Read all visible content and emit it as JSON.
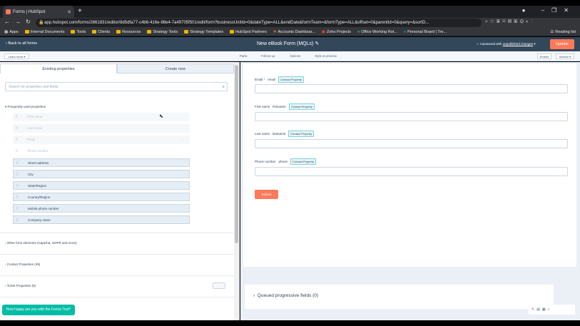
{
  "browser": {
    "tab_title": "Forms | HubSpot",
    "url": "app.hubspot.com/forms/2661831/editor/8d5dfa77-c4b6-416e-98e4-7a49705f501/edit/form?businessUnitId=0&dateType=ALL&endDate&formTeam=&formType=ALL&offset=0&parentId=0&query=&sortD...",
    "bookmarks": [
      "Apps",
      "Internal Documents",
      "Tools",
      "Clients",
      "Resources",
      "Strategy Tools",
      "Strategy Templates",
      "HubSpot Partners",
      "Accounts Dashboar...",
      "Zoho Projects",
      "Office Working Rot...",
      "Personal Board | Tre..."
    ],
    "reading_list": "Reading list"
  },
  "header": {
    "back_label": "Back to all forms",
    "form_title": "New eBook Form (MQLs)",
    "autosave_prefix": "Autosaved with",
    "autosave_link": "unpublished changes",
    "update_button": "Update"
  },
  "subnav": {
    "learn_more": "Learn more",
    "tabs": [
      "Form",
      "Follow-up",
      "Options",
      "Style & preview"
    ],
    "embed": "Embed",
    "actions": "Actions"
  },
  "left_panel": {
    "tabs": [
      "Existing properties",
      "Create new"
    ],
    "search_placeholder": "Search for properties and fields",
    "frequently_used": "Frequently used properties",
    "dim_fields": [
      "First name",
      "Last name",
      "Email",
      "Phone number"
    ],
    "active_fields": [
      "Street address",
      "City",
      "State/Region",
      "Country/Region",
      "Mobile phone number",
      "Company name"
    ],
    "other_elements": "Other form elements (Captcha, GDPR and more)",
    "contact_properties": "Contact Properties (49)",
    "ticket_properties": "Ticket Properties (9)",
    "feedback_button": "How happy are you with the Forms Tool?"
  },
  "form_preview": {
    "fields": [
      {
        "label": "Email *",
        "internal": "email",
        "badge": "Contact Property"
      },
      {
        "label": "First name",
        "internal": "firstname",
        "badge": "Contact Property"
      },
      {
        "label": "Last name",
        "internal": "lastname",
        "badge": "Contact Property"
      },
      {
        "label": "Phone number",
        "internal": "phone",
        "badge": "Contact Property"
      }
    ],
    "submit_label": "Submit",
    "queued_label": "Queued progressive fields (0)"
  },
  "colors": {
    "hubspot_header": "#33475b",
    "accent_orange": "#ff7a59",
    "teal": "#00bda5"
  }
}
